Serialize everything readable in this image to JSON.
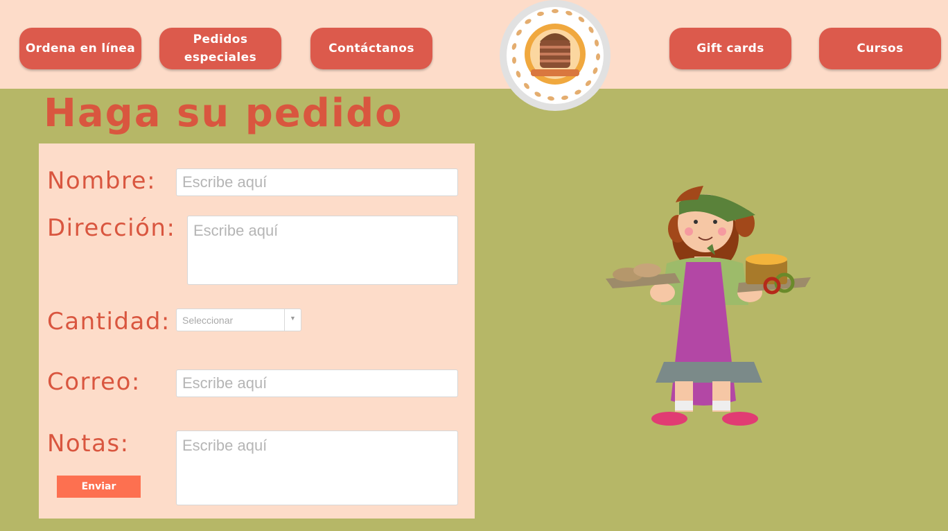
{
  "nav": {
    "ordena": "Ordena en línea",
    "pedidos": "Pedidos especiales",
    "contactanos": "Contáctanos",
    "giftcards": "Gift cards",
    "cursos": "Cursos"
  },
  "page": {
    "title": "Haga su pedido"
  },
  "form": {
    "nombre": {
      "label": "Nombre:",
      "placeholder": "Escribe aquí"
    },
    "direccion": {
      "label": "Dirección:",
      "placeholder": "Escribe aquí"
    },
    "cantidad": {
      "label": "Cantidad:",
      "value": "Seleccionar"
    },
    "correo": {
      "label": "Correo:",
      "placeholder": "Escribe aquí"
    },
    "notas": {
      "label": "Notas:",
      "placeholder": "Escribe aquí"
    },
    "submit": "Enviar"
  },
  "icons": {
    "logo": "bakery-logo-icon",
    "select_arrow": "chevron-down-icon",
    "illustration": "baker-woman-illustration"
  },
  "colors": {
    "header_bg": "#fddcc9",
    "page_bg": "#b6b767",
    "nav_button": "#dc5a4c",
    "title_text": "#d9563f",
    "submit_button": "#fd7050"
  }
}
